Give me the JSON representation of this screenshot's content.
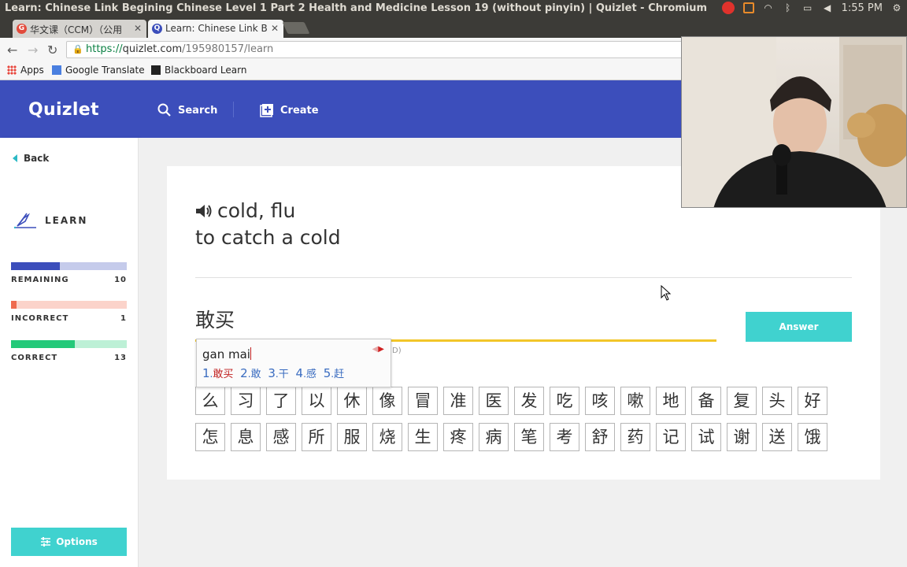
{
  "os": {
    "window_title": "Learn: Chinese Link Begining Chinese Level 1 Part 2 Health and Medicine Lesson 19 (without pinyin) | Quizlet - Chromium",
    "clock": "1:55 PM"
  },
  "browser": {
    "tabs": [
      {
        "label": "华文课（CCM）（公用",
        "favicon": "G"
      },
      {
        "label": "Learn: Chinese Link B",
        "favicon": "Q"
      }
    ],
    "url_scheme": "https://",
    "url_host": "quizlet.com",
    "url_path": "/195980157/learn",
    "bookmarks": [
      "Apps",
      "Google Translate",
      "Blackboard Learn"
    ]
  },
  "header": {
    "logo": "Quizlet",
    "search_label": "Search",
    "create_label": "Create",
    "brand_color": "#3c4ebb"
  },
  "sidebar": {
    "back_label": "Back",
    "mode_label": "LEARN",
    "progress": [
      {
        "label": "REMAINING",
        "count": "10",
        "fraction": 0.42,
        "fill": "#3c4ebb",
        "track": "#c5cbeb"
      },
      {
        "label": "INCORRECT",
        "count": "1",
        "fraction": 0.05,
        "fill": "#ef6a4e",
        "track": "#fbd3ca"
      },
      {
        "label": "CORRECT",
        "count": "13",
        "fraction": 0.55,
        "fill": "#24c979",
        "track": "#bdf0d6"
      }
    ],
    "options_label": "Options"
  },
  "question": {
    "line1": "cold, flu",
    "line2": "to catch a cold",
    "typed_answer": "敢买",
    "answer_button": "Answer",
    "hint_suffix": "D)"
  },
  "ime": {
    "input": "gan mai",
    "candidates": [
      {
        "num": "1",
        "word": "敢买"
      },
      {
        "num": "2",
        "word": "敢"
      },
      {
        "num": "3",
        "word": "干"
      },
      {
        "num": "4",
        "word": "感"
      },
      {
        "num": "5",
        "word": "赶"
      }
    ]
  },
  "characters": {
    "row1": [
      "么",
      "习",
      "了",
      "以",
      "休",
      "像",
      "冒",
      "准",
      "医",
      "发",
      "吃",
      "咳",
      "嗽",
      "地",
      "备",
      "复",
      "头",
      "好"
    ],
    "row2": [
      "怎",
      "息",
      "感",
      "所",
      "服",
      "烧",
      "生",
      "疼",
      "病",
      "笔",
      "考",
      "舒",
      "药",
      "记",
      "试",
      "谢",
      "送",
      "饿"
    ]
  }
}
